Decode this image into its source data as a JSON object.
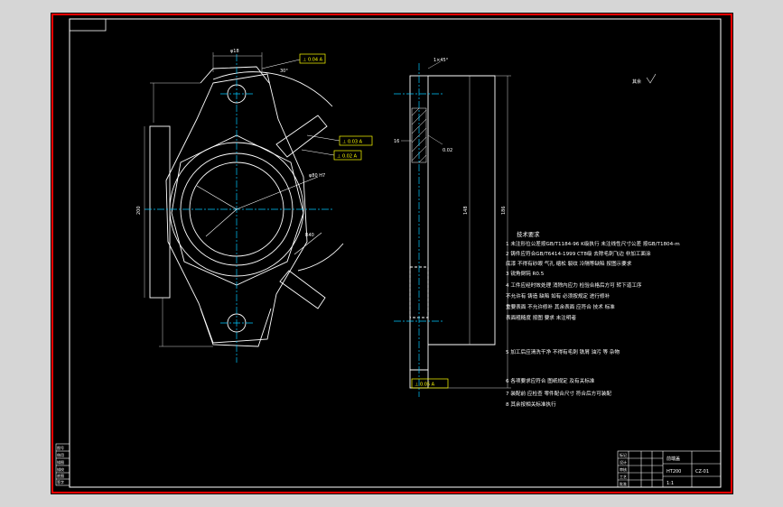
{
  "drawing": {
    "colors": {
      "background": "#000000",
      "border_outer": "#ff0000",
      "frame": "#ffffff",
      "centerline": "#00c8ff",
      "callout": "#ffff00",
      "dimension": "#d0d0d0"
    },
    "notes": {
      "title": "技术要求",
      "lines": [
        "1  未注形位公差按GB/T1184-96 K级执行  未注线性尺寸公差  按GB/T1804-m",
        "2  铸件应符合GB/T6414-1999 CT8级  去除毛刺飞边  非加工面涂",
        "   底漆  不得有砂眼  气孔  缩松  裂纹  冷隔等缺陷  按图示要求",
        "3  锐角倒钝  R0.5",
        "4  工件应经时效处理  消除内应力  检验合格后方可  转下道工序",
        "   不允许有  铸造  缺陷  如有  必须按规定  进行修补",
        "   重要表面  不允许修补  其余表面  应符合  技术  标准",
        "   表面粗糙度  按图  要求  未注明者",
        "5  加工后应清洗干净  不得有毛刺  铁屑  油污  等  杂物",
        "6  各项要求应符合  图纸规定  及有关标准",
        "7  装配前  应检查  零件配合尺寸  符合后方可装配",
        "8  其余按相关标准执行"
      ]
    },
    "callouts": {
      "top_fcf": "⊥ 0.04 A",
      "side_fcf": "⊥ 0.03 A",
      "side_fcf2": "⊥ 0.02 A",
      "bottom_fcf": "⊥ 0.05 A",
      "ra_note": "其余"
    },
    "dimensions": {
      "top_width": "φ18",
      "top_label": "30°",
      "bore": "φ80 H7",
      "radius": "R40",
      "height_left": "200",
      "height_right": "148",
      "height_far": "186",
      "section_top": "1×45°",
      "section_left": "16",
      "section_mid": "0.02"
    },
    "title_block": {
      "part_name": "前端盖",
      "drawing_no": "CZ-01",
      "material": "HT200",
      "scale": "1:1",
      "rows": [
        "标记",
        "设计",
        "审核",
        "工艺",
        "批准"
      ]
    },
    "revision_table": {
      "header": "图号",
      "rows": [
        "借用",
        "描图",
        "描校",
        "底图",
        "签字"
      ]
    }
  }
}
